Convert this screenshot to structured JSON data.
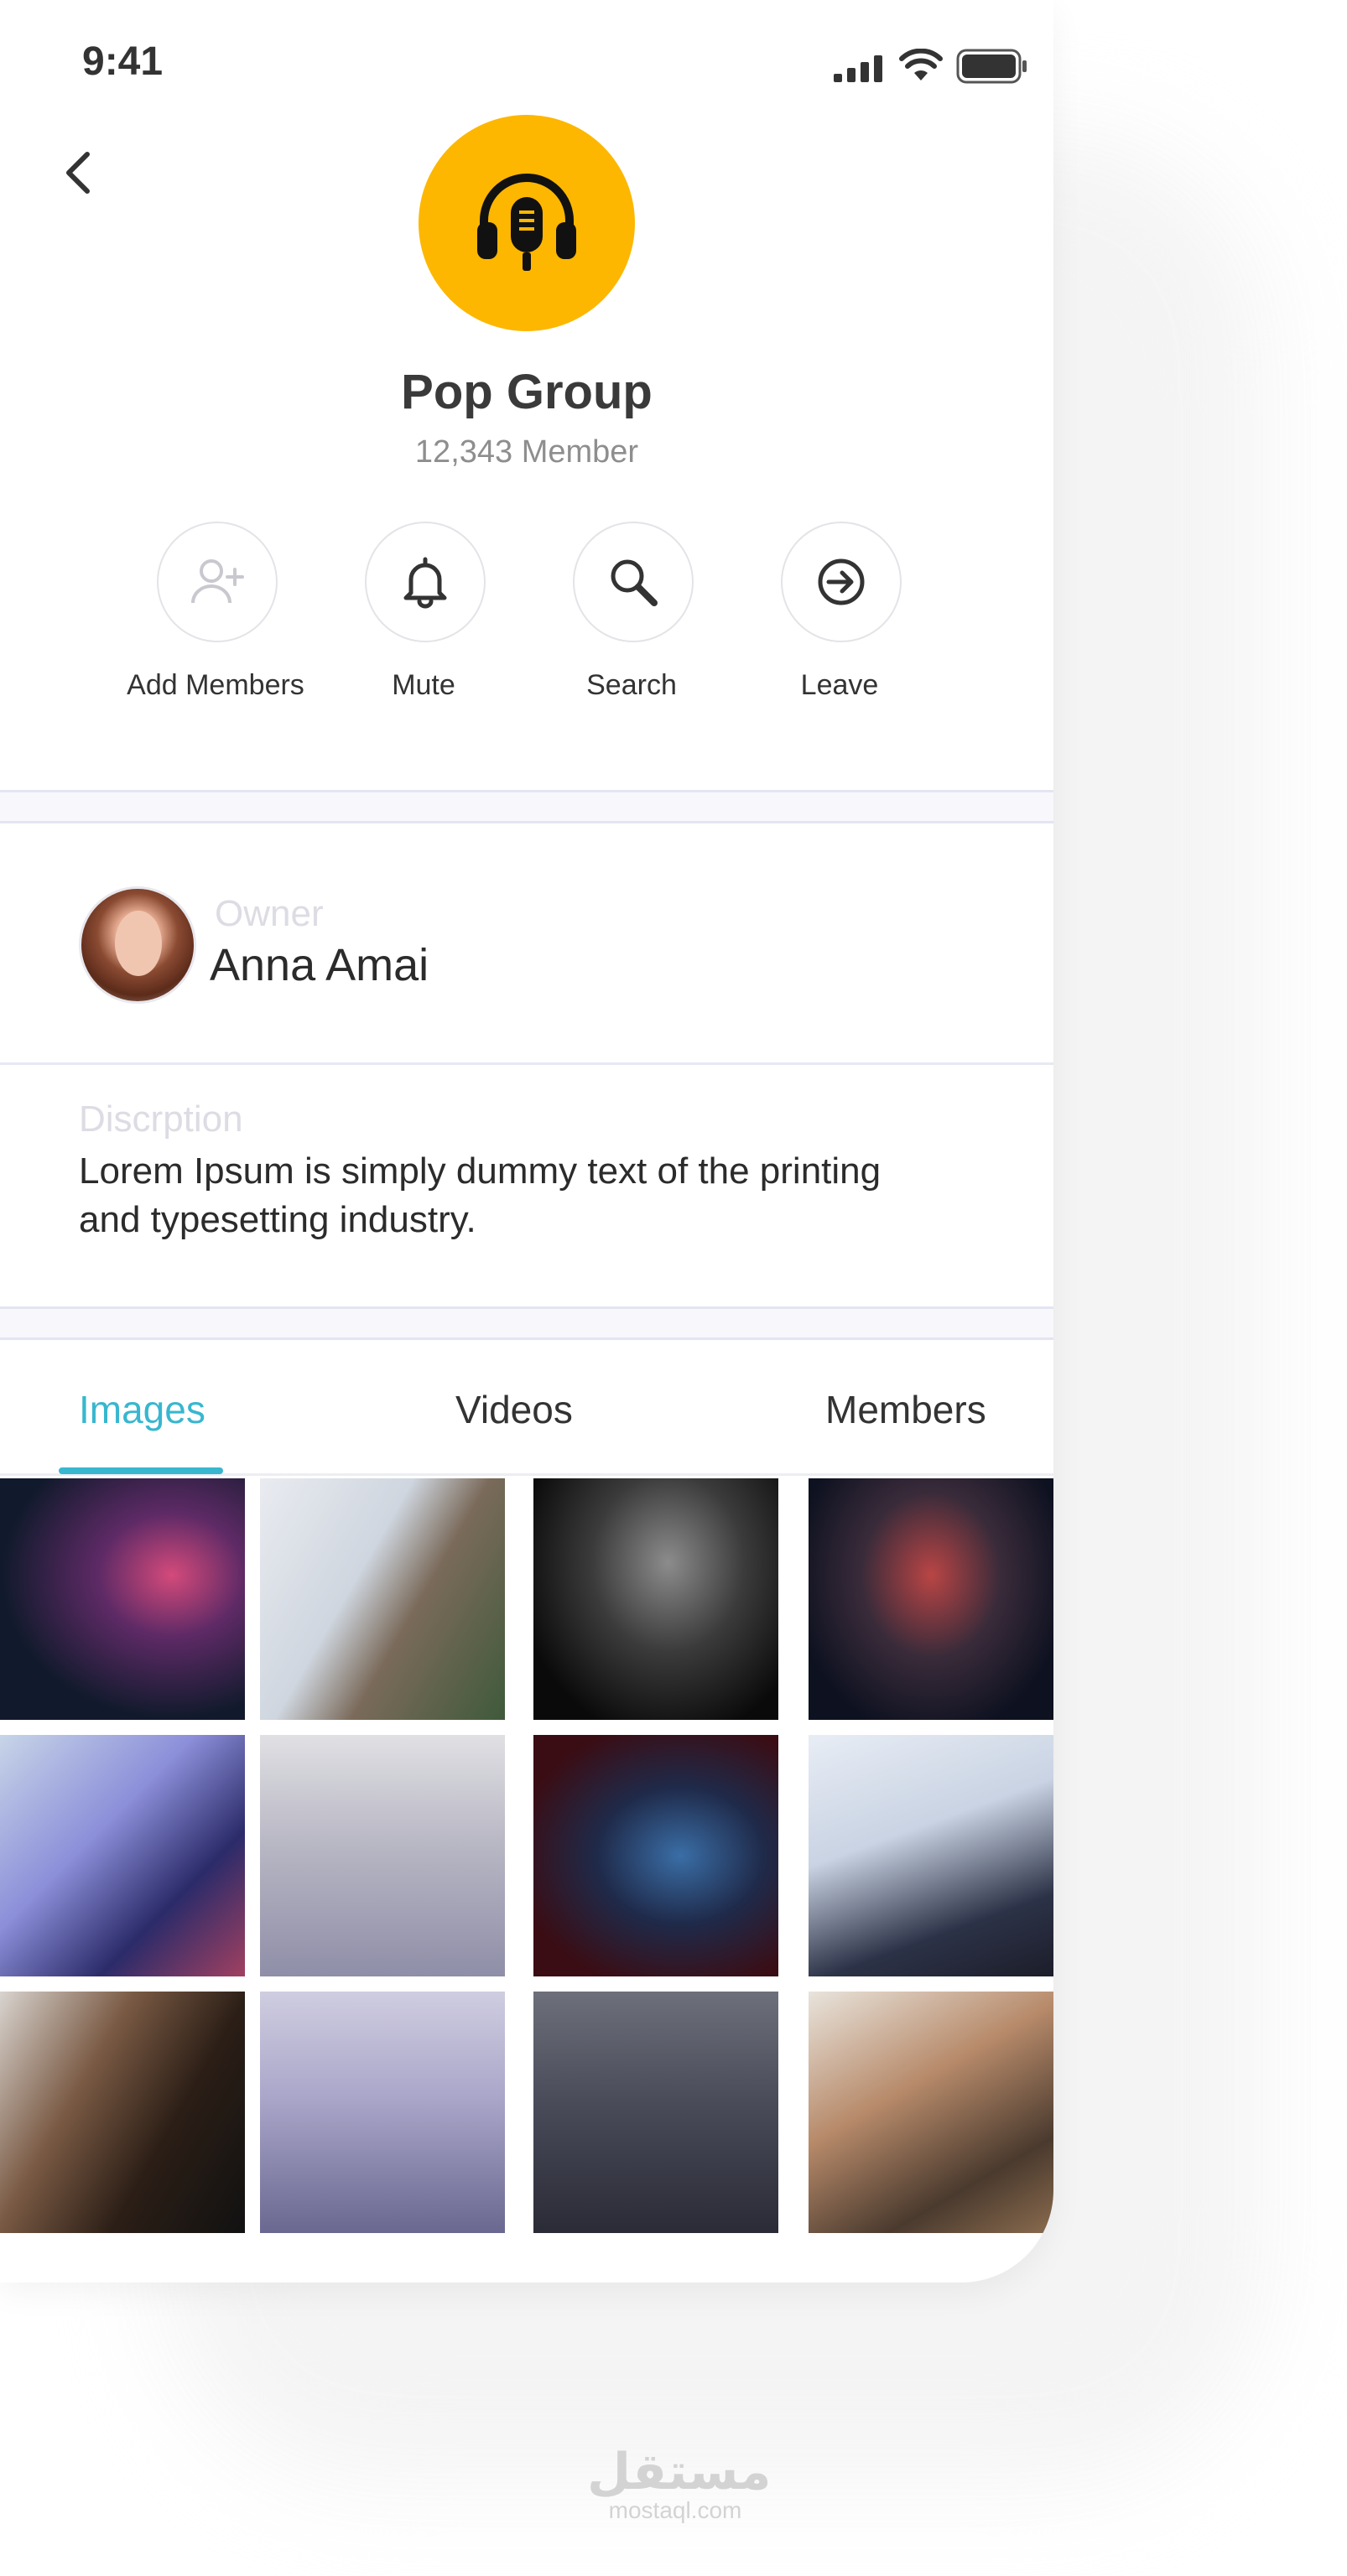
{
  "status_bar": {
    "time": "9:41"
  },
  "group": {
    "name": "Pop Group",
    "members": "12,343 Member",
    "avatar_color": "#FDB700",
    "avatar_icon": "headphones-microphone-icon"
  },
  "actions": [
    {
      "label": "Add Members",
      "icon": "add-user-icon"
    },
    {
      "label": "Mute",
      "icon": "bell-icon"
    },
    {
      "label": "Search",
      "icon": "search-icon"
    },
    {
      "label": "Leave",
      "icon": "leave-icon"
    }
  ],
  "owner": {
    "label": "Owner",
    "name": "Anna Amai"
  },
  "description": {
    "label": "Discrption",
    "text": "Lorem Ipsum is simply dummy text of the printing and typesetting industry."
  },
  "tabs": [
    {
      "label": "Images",
      "active": true
    },
    {
      "label": "Videos",
      "active": false
    },
    {
      "label": "Members",
      "active": false
    }
  ],
  "colors": {
    "accent": "#38B7CF",
    "avatar": "#FDB700"
  },
  "watermark": {
    "arabic": "مستقل",
    "latin": "mostaql.com"
  }
}
